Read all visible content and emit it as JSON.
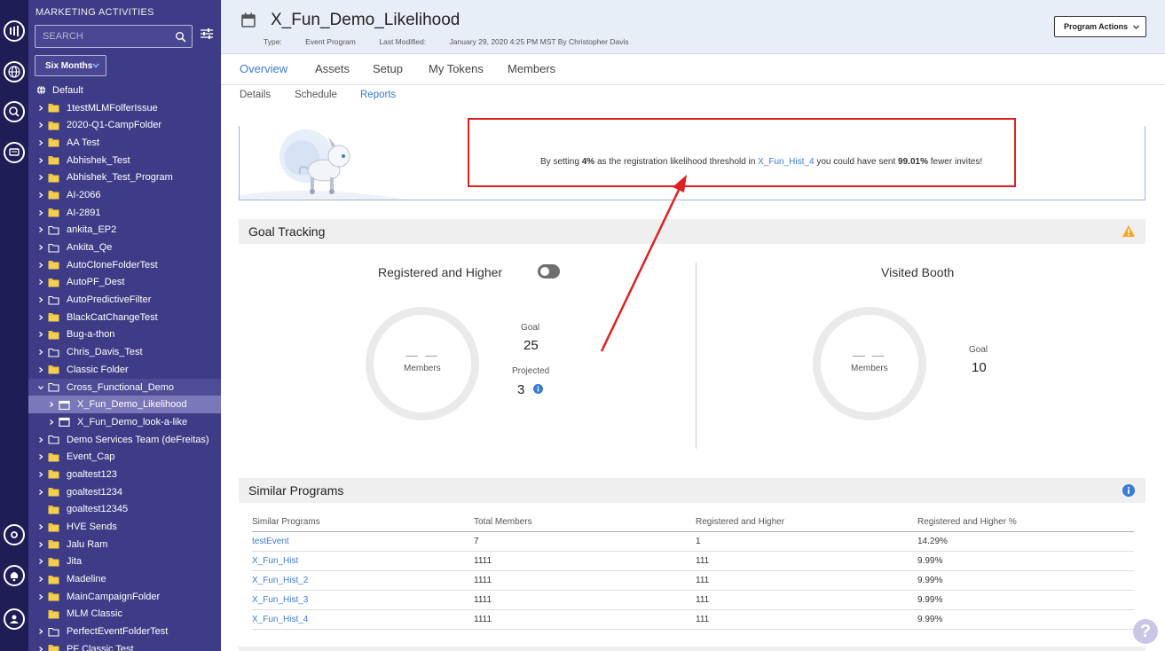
{
  "sidebar": {
    "title": "MARKETING ACTIVITIES",
    "search_placeholder": "SEARCH",
    "range_label": "Six Months",
    "root_label": "Default",
    "items": [
      {
        "label": "1testMLMFolferIssue",
        "icon": "folder-filled",
        "caret": true
      },
      {
        "label": "2020-Q1-CampFolder",
        "icon": "folder-filled",
        "caret": true
      },
      {
        "label": "AA Test",
        "icon": "folder-filled",
        "caret": true
      },
      {
        "label": "Abhishek_Test",
        "icon": "folder-filled",
        "caret": true
      },
      {
        "label": "Abhishek_Test_Program",
        "icon": "folder-filled",
        "caret": true
      },
      {
        "label": "AI-2066",
        "icon": "folder-filled",
        "caret": true
      },
      {
        "label": "AI-2891",
        "icon": "folder-filled",
        "caret": true
      },
      {
        "label": "ankita_EP2",
        "icon": "folder-outline",
        "caret": true
      },
      {
        "label": "Ankita_Qe",
        "icon": "folder-outline",
        "caret": true
      },
      {
        "label": "AutoCloneFolderTest",
        "icon": "folder-filled",
        "caret": true
      },
      {
        "label": "AutoPF_Dest",
        "icon": "folder-filled",
        "caret": true
      },
      {
        "label": "AutoPredictiveFilter",
        "icon": "folder-outline",
        "caret": true
      },
      {
        "label": "BlackCatChangeTest",
        "icon": "folder-filled",
        "caret": true
      },
      {
        "label": "Bug-a-thon",
        "icon": "folder-filled",
        "caret": true
      },
      {
        "label": "Chris_Davis_Test",
        "icon": "folder-outline",
        "caret": true
      },
      {
        "label": "Classic Folder",
        "icon": "folder-filled",
        "caret": true
      },
      {
        "label": "Cross_Functional_Demo",
        "icon": "folder-outline",
        "caret": true,
        "expanded": true
      },
      {
        "label": "X_Fun_Demo_Likelihood",
        "icon": "calendar",
        "caret": true,
        "child": true,
        "selected": true
      },
      {
        "label": "X_Fun_Demo_look-a-like",
        "icon": "calendar",
        "caret": true,
        "child": true
      },
      {
        "label": "Demo Services Team (deFreitas)",
        "icon": "folder-outline",
        "caret": true
      },
      {
        "label": "Event_Cap",
        "icon": "folder-filled",
        "caret": true
      },
      {
        "label": "goaltest123",
        "icon": "folder-filled",
        "caret": true
      },
      {
        "label": "goaltest1234",
        "icon": "folder-filled",
        "caret": true
      },
      {
        "label": "goaltest12345",
        "icon": "folder-filled",
        "caret": false
      },
      {
        "label": "HVE Sends",
        "icon": "folder-filled",
        "caret": true
      },
      {
        "label": "Jalu Ram",
        "icon": "folder-filled",
        "caret": true
      },
      {
        "label": "Jita",
        "icon": "folder-filled",
        "caret": true
      },
      {
        "label": "Madeline",
        "icon": "folder-filled",
        "caret": true
      },
      {
        "label": "MainCampaignFolder",
        "icon": "folder-filled",
        "caret": true
      },
      {
        "label": "MLM Classic",
        "icon": "folder-filled",
        "caret": false
      },
      {
        "label": "PerfectEventFolderTest",
        "icon": "folder-outline",
        "caret": true
      },
      {
        "label": "PF Classic Test",
        "icon": "folder-filled",
        "caret": true
      }
    ]
  },
  "header": {
    "title": "X_Fun_Demo_Likelihood",
    "type_label": "Type:",
    "type_value": "Event Program",
    "modified_label": "Last Modified:",
    "modified_value": "January 29, 2020 4:25 PM MST By Christopher Davis",
    "actions_label": "Program Actions"
  },
  "tabs": [
    "Overview",
    "Assets",
    "Setup",
    "My Tokens",
    "Members"
  ],
  "subtabs": [
    "Details",
    "Schedule",
    "Reports"
  ],
  "banner": {
    "prefix": "By setting",
    "threshold": "4%",
    "middle": "as the registration likelihood threshold in",
    "link": "X_Fun_Hist_4",
    "middle2": "you could have sent",
    "percent": "99.01%",
    "suffix": "fewer invites!"
  },
  "goal_tracking": {
    "title": "Goal Tracking",
    "left": {
      "title": "Registered and Higher",
      "members_dash": "— —",
      "members_label": "Members",
      "goal_label": "Goal",
      "goal_value": "25",
      "projected_label": "Projected",
      "projected_value": "3"
    },
    "right": {
      "title": "Visited Booth",
      "members_dash": "— —",
      "members_label": "Members",
      "goal_label": "Goal",
      "goal_value": "10"
    }
  },
  "similar_programs": {
    "title": "Similar Programs",
    "columns": [
      "Similar Programs",
      "Total Members",
      "Registered and Higher",
      "Registered and Higher %"
    ],
    "rows": [
      [
        "testEvent",
        "7",
        "1",
        "14.29%"
      ],
      [
        "X_Fun_Hist",
        "1111",
        "111",
        "9.99%"
      ],
      [
        "X_Fun_Hist_2",
        "1111",
        "111",
        "9.99%"
      ],
      [
        "X_Fun_Hist_3",
        "1111",
        "111",
        "9.99%"
      ],
      [
        "X_Fun_Hist_4",
        "1111",
        "111",
        "9.99%"
      ]
    ]
  },
  "help_label": "?",
  "colors": {
    "accent": "#3a7bd5",
    "sidebar": "#3f3c87",
    "rail": "#1f1d55",
    "callout": "#e02020",
    "warning": "#f5a623"
  }
}
